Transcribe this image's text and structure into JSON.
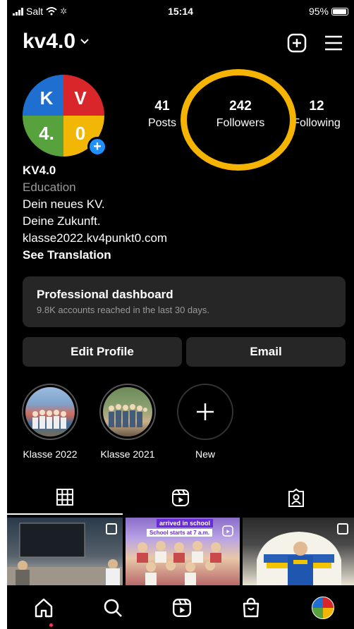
{
  "status": {
    "carrier": "Salt",
    "time": "15:14",
    "battery": "95%",
    "battery_level": 0.95
  },
  "profile": {
    "username": "kv4.0",
    "avatar_letters": [
      "K",
      "V",
      "4.",
      "0"
    ],
    "stats": [
      {
        "value": "41",
        "label": "Posts"
      },
      {
        "value": "242",
        "label": "Followers"
      },
      {
        "value": "12",
        "label": "Following"
      }
    ],
    "name": "KV4.0",
    "category": "Education",
    "bio_lines": [
      "Dein neues KV.",
      "Deine Zukunft."
    ],
    "link": "klasse2022.kv4punkt0.com",
    "translation": "See Translation"
  },
  "dashboard": {
    "title": "Professional dashboard",
    "subtitle": "9.8K accounts reached in the last 30 days."
  },
  "buttons": {
    "edit": "Edit Profile",
    "email": "Email"
  },
  "highlights": [
    {
      "label": "Klasse 2022"
    },
    {
      "label": "Klasse 2021"
    },
    {
      "label": "New"
    }
  ],
  "posts": {
    "banner_line1": "arrived in school",
    "banner_line2": "School starts at 7 a.m."
  },
  "colors": {
    "highlight_circle": "#f6b402",
    "badge": "#1e90ff",
    "k_blue": "#1f6fd0",
    "v_red": "#d8262b",
    "four_green": "#58a23d",
    "zero_yellow": "#f2b705"
  }
}
